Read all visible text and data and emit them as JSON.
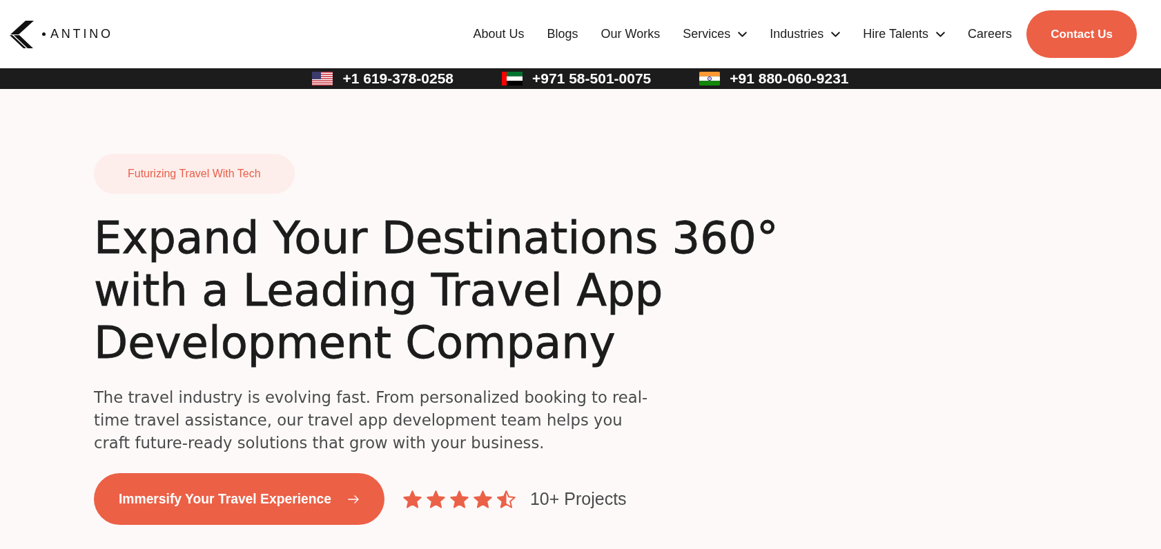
{
  "header": {
    "logo": "ANTINO",
    "nav": [
      {
        "label": "About Us",
        "dropdown": false
      },
      {
        "label": "Blogs",
        "dropdown": false
      },
      {
        "label": "Our Works",
        "dropdown": false
      },
      {
        "label": "Services",
        "dropdown": true
      },
      {
        "label": "Industries",
        "dropdown": true
      },
      {
        "label": "Hire Talents",
        "dropdown": true
      },
      {
        "label": "Careers",
        "dropdown": false
      }
    ],
    "contact_button": "Contact Us"
  },
  "phone_bar": [
    {
      "kind": "us",
      "number": "+1 619-378-0258"
    },
    {
      "kind": "uae",
      "number": "+971 58-501-0075"
    },
    {
      "kind": "india",
      "number": "+91 880-060-9231"
    }
  ],
  "hero": {
    "badge": "Futurizing Travel With Tech",
    "heading": "Expand Your Destinations 360° with a Leading Travel App Development Company",
    "description": "The travel industry is evolving fast. From personalized booking to real-time travel assistance, our travel app development team helps you craft future-ready solutions that grow with your business.",
    "button": "Immersify Your Travel Experience",
    "rating": {
      "stars": 4.5,
      "label": "10+ Projects"
    }
  }
}
